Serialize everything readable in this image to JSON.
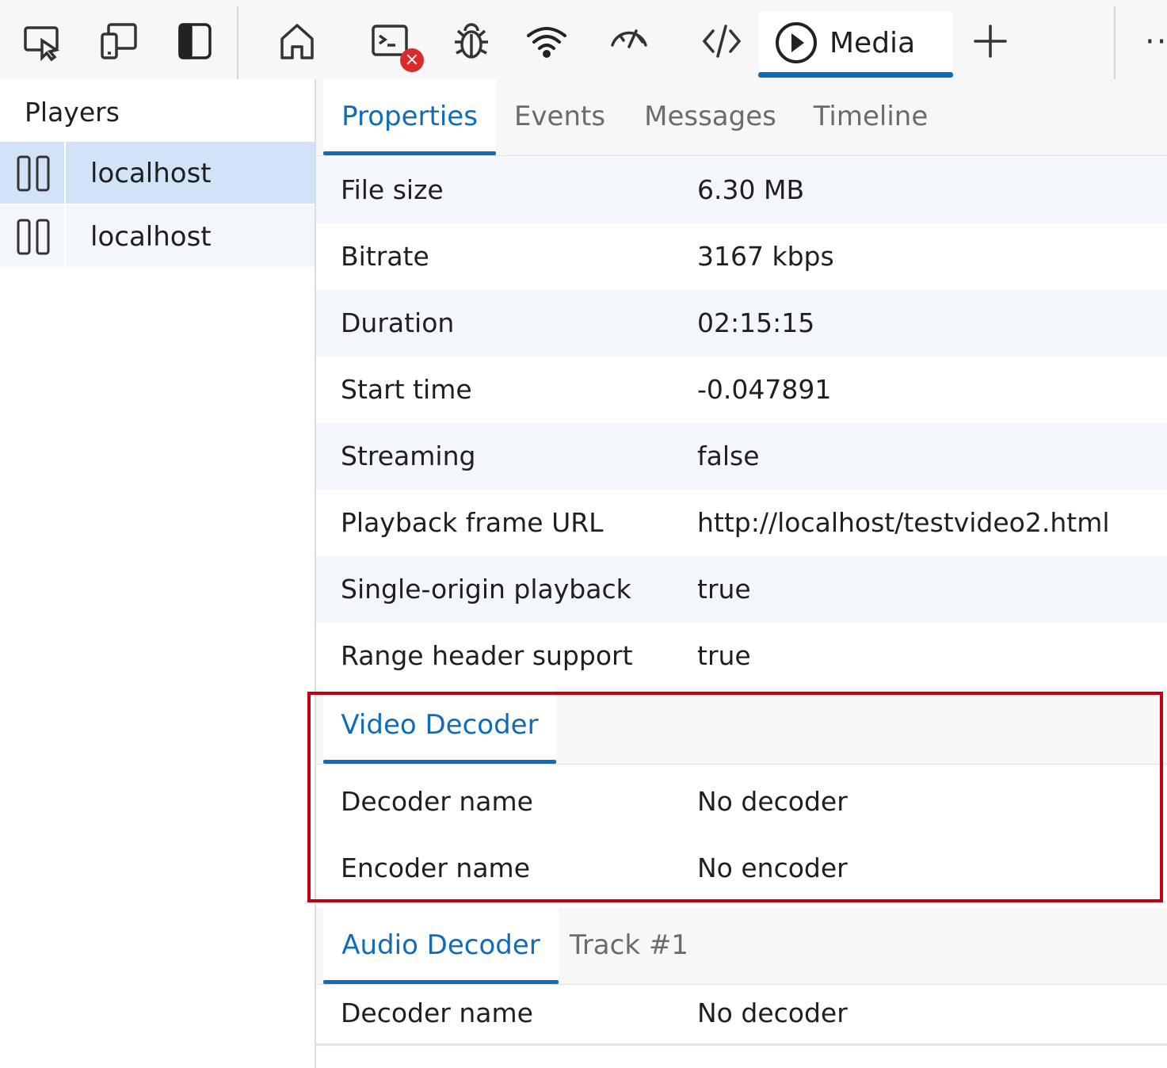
{
  "toolbar": {
    "icons": [
      "inspect-icon",
      "device-emulation-icon",
      "dock-side-icon",
      "home-icon",
      "console-icon",
      "bug-icon",
      "network-wifi-icon",
      "performance-gauge-icon",
      "code-icon"
    ],
    "active_tab_label": "Media",
    "error_badge": "×",
    "more_label": "··"
  },
  "sidebar": {
    "title": "Players",
    "players": [
      {
        "name": "localhost",
        "selected": true
      },
      {
        "name": "localhost",
        "selected": false
      }
    ]
  },
  "main": {
    "tabs": [
      "Properties",
      "Events",
      "Messages",
      "Timeline"
    ],
    "active_tab": "Properties",
    "properties": [
      {
        "key": "File size",
        "value": "6.30 MB"
      },
      {
        "key": "Bitrate",
        "value": "3167 kbps"
      },
      {
        "key": "Duration",
        "value": "02:15:15"
      },
      {
        "key": "Start time",
        "value": "-0.047891"
      },
      {
        "key": "Streaming",
        "value": "false"
      },
      {
        "key": "Playback frame URL",
        "value": "http://localhost/testvideo2.html"
      },
      {
        "key": "Single-origin playback",
        "value": "true"
      },
      {
        "key": "Range header support",
        "value": "true"
      }
    ],
    "video_decoder": {
      "tab": "Video Decoder",
      "rows": [
        {
          "key": "Decoder name",
          "value": "No decoder"
        },
        {
          "key": "Encoder name",
          "value": "No encoder"
        }
      ]
    },
    "audio_decoder": {
      "tabs": [
        "Audio Decoder",
        "Track #1"
      ],
      "rows": [
        {
          "key": "Decoder name",
          "value": "No decoder"
        }
      ]
    }
  },
  "colors": {
    "accent": "#0f6cbd",
    "highlight_border": "#c00012",
    "selected_row": "#d2e3f7",
    "error_badge": "#d92b2b"
  }
}
